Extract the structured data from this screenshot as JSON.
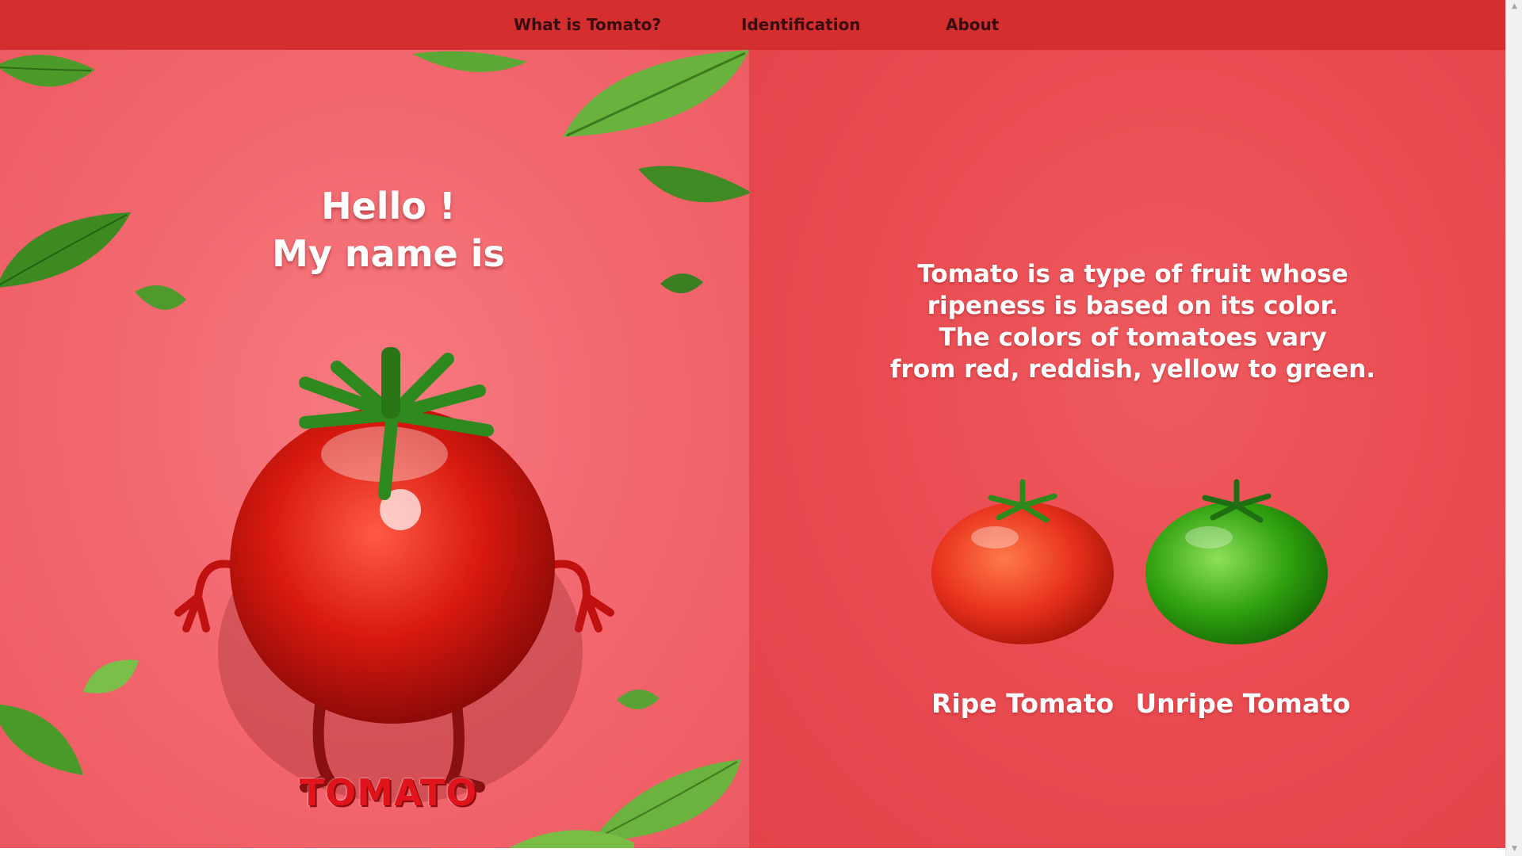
{
  "nav": {
    "items": [
      {
        "label": "What is Tomato?"
      },
      {
        "label": "Identification"
      },
      {
        "label": "About"
      }
    ]
  },
  "hero": {
    "greeting_line1": "Hello !",
    "greeting_line2": "My name is",
    "brand": "TOMATO"
  },
  "info": {
    "lines": [
      "Tomato is a type of fruit whose",
      "ripeness is based on its color.",
      "The colors of tomatoes vary",
      "from red, reddish, yellow to green."
    ]
  },
  "fruits": [
    {
      "label": "Ripe Tomato",
      "color": "#e8301c"
    },
    {
      "label": "Unripe Tomato",
      "color": "#2fa00f"
    }
  ],
  "colors": {
    "nav_bg": "#d42e2f",
    "left_bg": "#f2666d",
    "right_bg": "#e94b51",
    "leaf": "#4c9a2a"
  }
}
